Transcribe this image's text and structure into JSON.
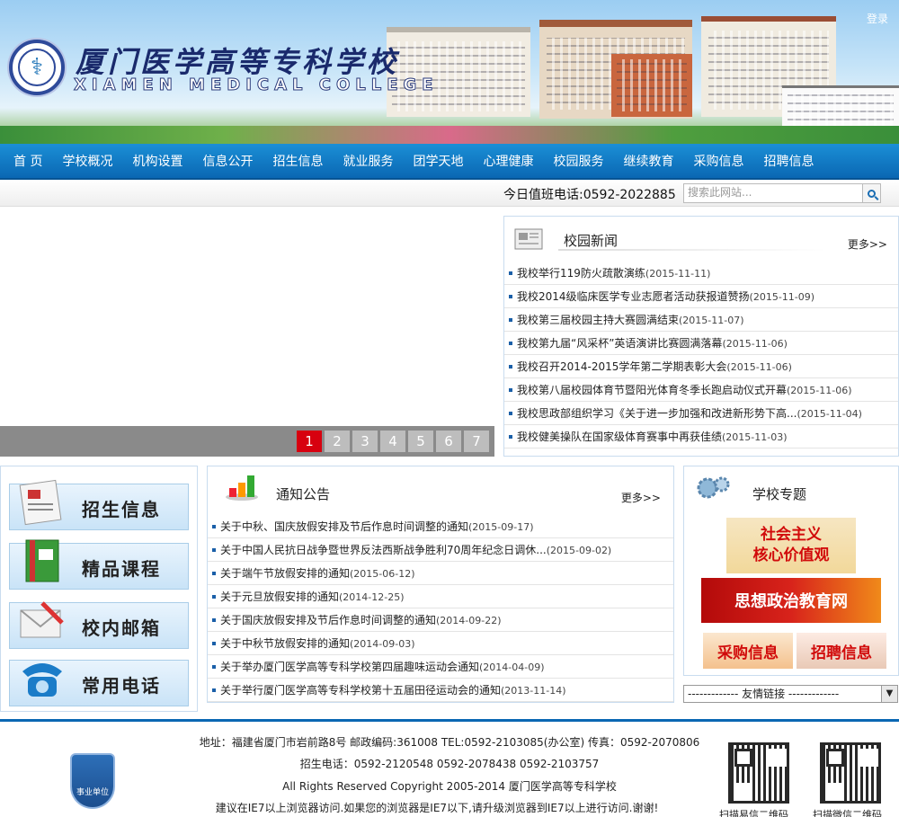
{
  "header": {
    "login_label": "登录",
    "school_name_cn": "厦门医学高等专科学校",
    "school_name_en": "XIAMEN MEDICAL COLLEGE"
  },
  "nav": {
    "items": [
      "首 页",
      "学校概况",
      "机构设置",
      "信息公开",
      "招生信息",
      "就业服务",
      "团学天地",
      "心理健康",
      "校园服务",
      "继续教育",
      "采购信息",
      "招聘信息"
    ]
  },
  "strip": {
    "duty_phone": "今日值班电话:0592-2022885",
    "search_placeholder": "搜索此网站..."
  },
  "slider": {
    "pages": [
      "1",
      "2",
      "3",
      "4",
      "5",
      "6",
      "7"
    ],
    "active_page": "1"
  },
  "campus_news": {
    "title": "校园新闻",
    "more": "更多>>",
    "items": [
      {
        "text": "我校举行119防火疏散演练",
        "date": "(2015-11-11)"
      },
      {
        "text": "我校2014级临床医学专业志愿者活动获报道赞扬",
        "date": "(2015-11-09)"
      },
      {
        "text": "我校第三届校园主持大赛圆满结束",
        "date": "(2015-11-07)"
      },
      {
        "text": "我校第九届“风采杯”英语演讲比赛圆满落幕",
        "date": "(2015-11-06)"
      },
      {
        "text": "我校召开2014-2015学年第二学期表彰大会",
        "date": "(2015-11-06)"
      },
      {
        "text": "我校第八届校园体育节暨阳光体育冬季长跑启动仪式开幕",
        "date": "(2015-11-06)"
      },
      {
        "text": "我校思政部组织学习《关于进一步加强和改进新形势下高...",
        "date": "(2015-11-04)"
      },
      {
        "text": "我校健美操队在国家级体育赛事中再获佳绩",
        "date": "(2015-11-03)"
      }
    ]
  },
  "quick_links": [
    "招生信息",
    "精品课程",
    "校内邮箱",
    "常用电话"
  ],
  "notices": {
    "title": "通知公告",
    "more": "更多>>",
    "items": [
      {
        "text": "关于中秋、国庆放假安排及节后作息时间调整的通知",
        "date": "(2015-09-17)"
      },
      {
        "text": "关于中国人民抗日战争暨世界反法西斯战争胜利70周年纪念日调休...",
        "date": "(2015-09-02)"
      },
      {
        "text": "关于端午节放假安排的通知",
        "date": "(2015-06-12)"
      },
      {
        "text": "关于元旦放假安排的通知",
        "date": "(2014-12-25)"
      },
      {
        "text": "关于国庆放假安排及节后作息时间调整的通知",
        "date": "(2014-09-22)"
      },
      {
        "text": "关于中秋节放假安排的通知",
        "date": "(2014-09-03)"
      },
      {
        "text": "关于举办厦门医学高等专科学校第四届趣味运动会通知",
        "date": "(2014-04-09)"
      },
      {
        "text": "关于举行厦门医学高等专科学校第十五届田径运动会的通知",
        "date": "(2013-11-14)"
      }
    ]
  },
  "topics": {
    "title": "学校专题",
    "core_values_line1": "社会主义",
    "core_values_line2": "核心价值观",
    "ideology": "思想政治教育网",
    "procurement": "采购信息",
    "recruitment": "招聘信息"
  },
  "friend_links": "------------- 友情链接 -------------",
  "footer": {
    "address": "地址：福建省厦门市岩前路8号 邮政编码:361008 TEL:0592-2103085(办公室) 传真：0592-2070806",
    "admission_phone": "招生电话：0592-2120548   0592-2078438   0592-2103757",
    "copyright": "All Rights Reserved Copyright 2005-2014 厦门医学高等专科学校",
    "browser_note": "建议在IE7以上浏览器访问.如果您的浏览器是IE7以下,请升级浏览器到IE7以上进行访问.谢谢!",
    "badge": "事业单位",
    "qr1_caption": "扫描易信二维码",
    "qr2_caption": "扫描微信二维码"
  }
}
